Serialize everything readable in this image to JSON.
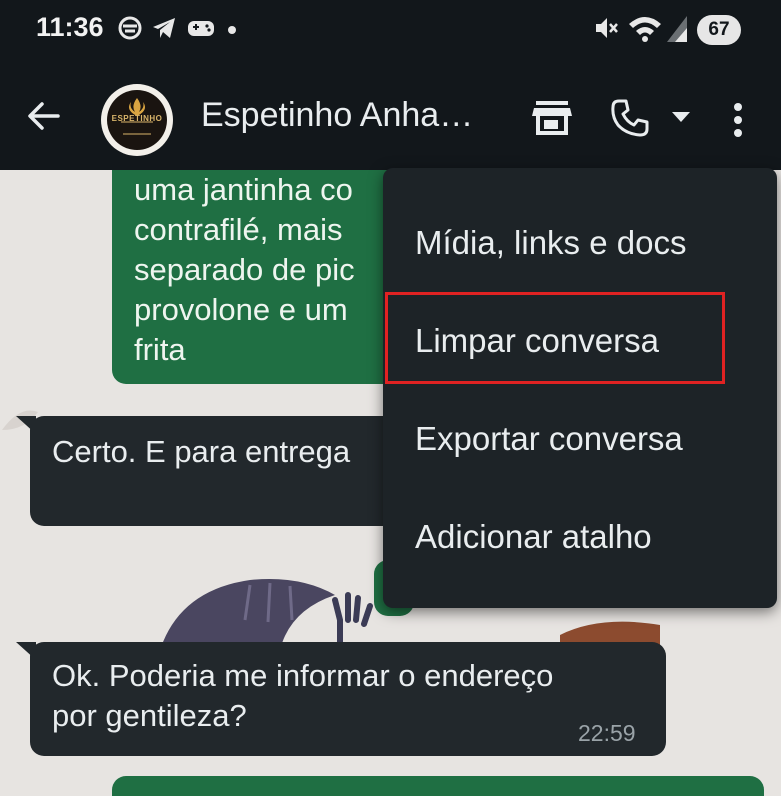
{
  "status_bar": {
    "time": "11:36",
    "battery": "67",
    "icons": [
      "hedgehog-app-icon",
      "telegram-icon",
      "game-controller-icon",
      "notification-dot",
      "mute-icon",
      "wifi-icon",
      "signal-icon",
      "battery-icon"
    ]
  },
  "header": {
    "contact_name": "Espetinho Anha…",
    "avatar_text": "ESPETINHO",
    "icons": [
      "back-arrow-icon",
      "store-icon",
      "phone-icon",
      "dropdown-caret-icon",
      "more-vert-icon"
    ]
  },
  "messages": {
    "outgoing_1": {
      "lines": [
        "uma jantinha co",
        "contrafilé, mais",
        "separado de pic",
        "provolone e um",
        "frita"
      ]
    },
    "incoming_1": {
      "text": "Certo. E para entrega"
    },
    "incoming_2": {
      "lines": [
        "Ok. Poderia me informar o endereço",
        "por gentileza?"
      ],
      "time": "22:59"
    }
  },
  "menu": {
    "items": [
      {
        "label": "Mídia, links e docs"
      },
      {
        "label": "Limpar conversa"
      },
      {
        "label": "Exportar conversa"
      },
      {
        "label": "Adicionar atalho"
      }
    ]
  },
  "colors": {
    "bar_bg": "#12171b",
    "outgoing_bubble": "#1f6f43",
    "incoming_bubble": "#22282c",
    "menu_bg": "#1d2327",
    "highlight": "#e02222",
    "chat_bg": "#e7e4e1"
  }
}
